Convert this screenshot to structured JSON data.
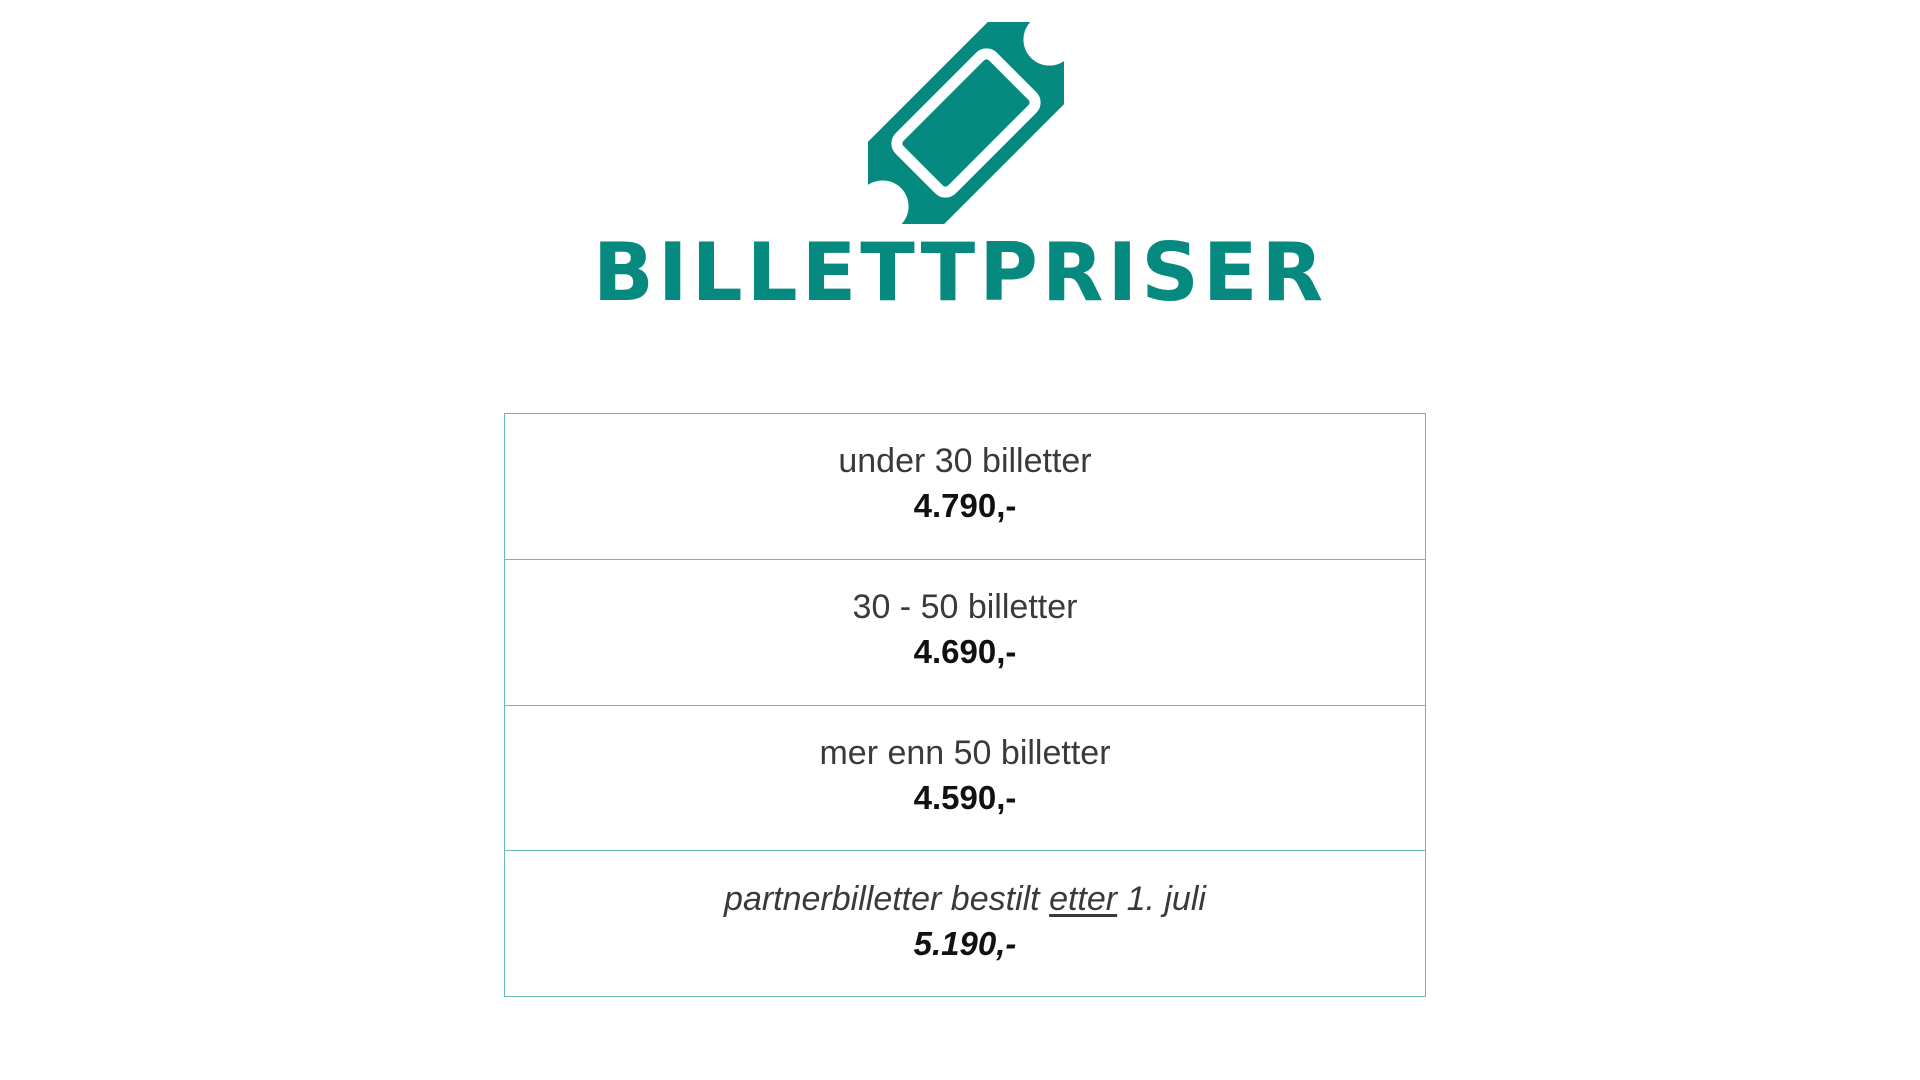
{
  "icon": "ticket-icon",
  "colors": {
    "accent": "#068a80",
    "table_border": "#6cb8b2",
    "text": "#3a3a3a",
    "price": "#111111",
    "background": "#ffffff"
  },
  "title": "BILLETTPRISER",
  "prices": [
    {
      "label": "under 30 billetter",
      "price": "4.790,-"
    },
    {
      "label": "30 - 50 billetter",
      "price": "4.690,-"
    },
    {
      "label": "mer enn 50 billetter",
      "price": "4.590,-"
    },
    {
      "label_before": "partnerbilletter bestilt ",
      "label_emphasis": "etter",
      "label_after": " 1. juli",
      "price": "5.190,-"
    }
  ]
}
